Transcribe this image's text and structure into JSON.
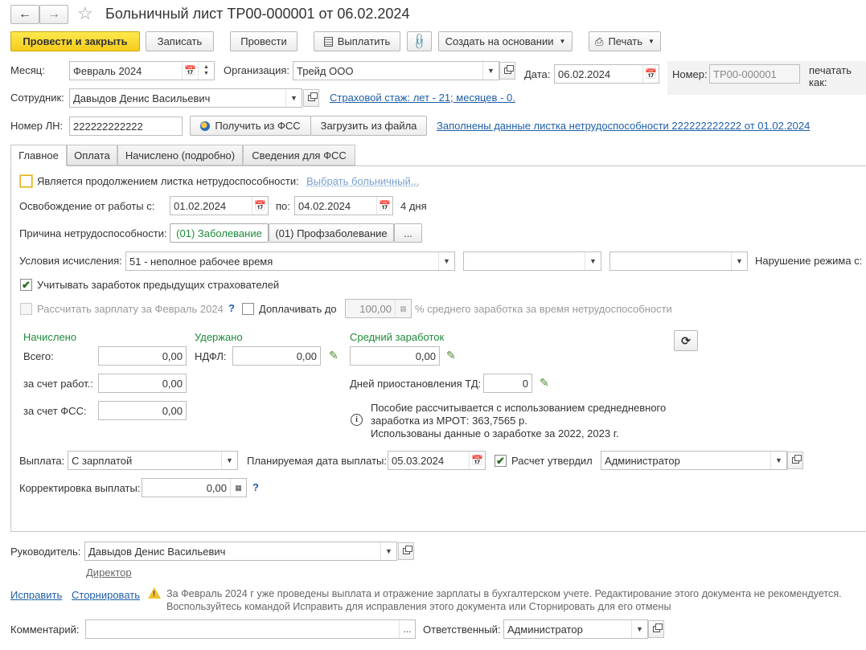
{
  "title": "Больничный лист ТР00-000001 от 06.02.2024",
  "toolbar": {
    "post_close": "Провести и закрыть",
    "save": "Записать",
    "post": "Провести",
    "pay": "Выплатить",
    "create_based": "Создать на основании",
    "print": "Печать"
  },
  "header": {
    "month_label": "Месяц:",
    "month_value": "Февраль 2024",
    "org_label": "Организация:",
    "org_value": "Трейд ООО",
    "date_label": "Дата:",
    "date_value": "06.02.2024",
    "number_label": "Номер:",
    "number_value": "ТР00-000001",
    "print_as_label": "печатать как:",
    "employee_label": "Сотрудник:",
    "employee_value": "Давыдов Денис Васильевич",
    "insurance_link": "Страховой стаж: лет - 21; месяцев - 0.",
    "ln_label": "Номер ЛН:",
    "ln_value": "222222222222",
    "get_fss": "Получить из ФСС",
    "load_file": "Загрузить из файла",
    "filled_link": "Заполнены данные листка нетрудоспособности 222222222222 от 01.02.2024"
  },
  "tabs": [
    "Главное",
    "Оплата",
    "Начислено (подробно)",
    "Сведения для ФСС"
  ],
  "main": {
    "continuation_label": "Является продолжением листка нетрудоспособности:",
    "choose_sick_link": "Выбрать больничный...",
    "release_label": "Освобождение от работы с:",
    "release_from": "01.02.2024",
    "to_label": "по:",
    "release_to": "04.02.2024",
    "days": "4 дня",
    "reason_label": "Причина нетрудоспособности:",
    "reason_1": "(01) Заболевание",
    "reason_2": "(01) Профзаболевание",
    "reason_more": "...",
    "conditions_label": "Условия исчисления:",
    "conditions_value": "51 - неполное рабочее время",
    "violation_label": "Нарушение режима с:",
    "prev_insurers_label": "Учитывать заработок предыдущих страхователей",
    "calc_salary_label": "Рассчитать зарплату за Февраль 2024",
    "help_mark": "?",
    "topup_label": "Доплачивать до",
    "topup_value": "100,00",
    "topup_suffix": "% среднего заработка за время нетрудоспособности",
    "accrued_header": "Начислено",
    "total_label": "Всего:",
    "total_value": "0,00",
    "employer_label": "за счет работ.:",
    "employer_value": "0,00",
    "fss_label": "за счет ФСС:",
    "fss_value": "0,00",
    "withheld_header": "Удержано",
    "ndfl_label": "НДФЛ:",
    "ndfl_value": "0,00",
    "avg_header": "Средний заработок",
    "avg_value": "0,00",
    "suspension_label": "Дней приостановления ТД:",
    "suspension_value": "0",
    "info_line1": "Пособие рассчитывается с использованием среднедневного",
    "info_line2": "заработка из МРОТ: 363,7565 р.",
    "info_line3": "Использованы данные о заработке за  2022,  2023 г.",
    "payout_label": "Выплата:",
    "payout_value": "С зарплатой",
    "planned_date_label": "Планируемая дата выплаты:",
    "planned_date_value": "05.03.2024",
    "approved_label": "Расчет утвердил",
    "approved_value": "Администратор",
    "correction_label": "Корректировка выплаты:",
    "correction_value": "0,00"
  },
  "footer": {
    "head_label": "Руководитель:",
    "head_value": "Давыдов Денис Васильевич",
    "head_position": "Директор",
    "fix_link": "Исправить",
    "reverse_link": "Сторнировать",
    "warning_line1": "За Февраль 2024 г уже проведены выплата и отражение зарплаты в бухгалтерском учете. Редактирование этого документа не рекомендуется.",
    "warning_line2": "Воспользуйтесь командой Исправить для исправления этого документа или Сторнировать для его отмены",
    "comment_label": "Комментарий:",
    "comment_value": "",
    "responsible_label": "Ответственный:",
    "responsible_value": "Администратор",
    "ellipsis": "..."
  },
  "icons": [
    "back-arrow-icon",
    "forward-arrow-icon",
    "star-icon",
    "calendar-icon",
    "dropdown-arrow-icon",
    "open-icon",
    "paperclip-icon",
    "printer-icon",
    "refresh-icon",
    "pencil-icon",
    "info-icon",
    "warning-icon",
    "calculator-icon",
    "fss-logo-icon"
  ],
  "colors": {
    "primary_button": "#f5cc1a",
    "link": "#1e5ea8",
    "section_header": "#1e8a3a"
  }
}
